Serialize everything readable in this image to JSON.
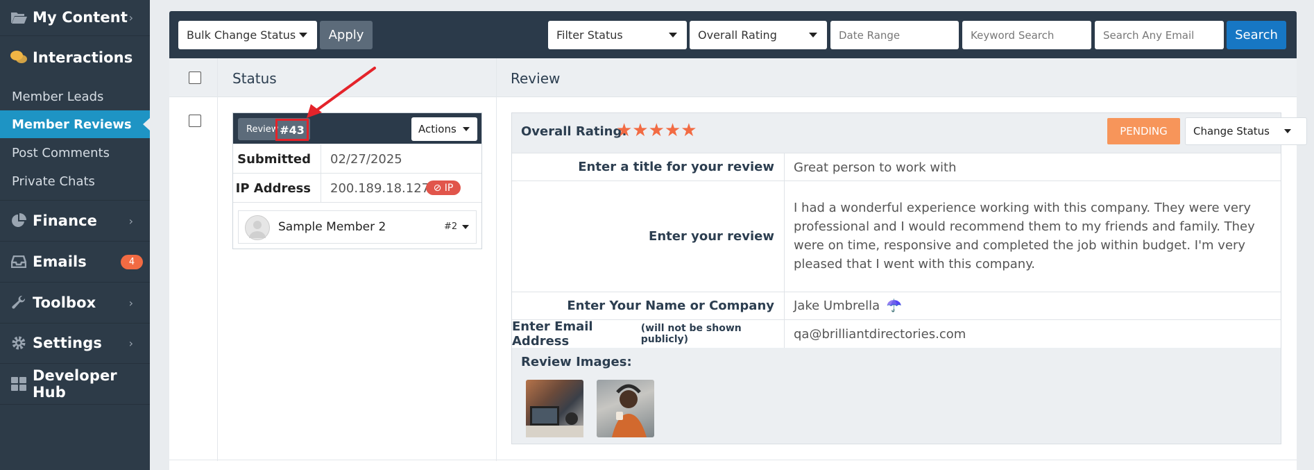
{
  "sidebar": {
    "items": [
      {
        "label": "My Content",
        "icon": "folder-open-icon"
      },
      {
        "label": "Interactions",
        "icon": "comments-icon"
      },
      {
        "label": "Finance",
        "icon": "pie-chart-icon"
      },
      {
        "label": "Emails",
        "icon": "inbox-icon",
        "badge": "4"
      },
      {
        "label": "Toolbox",
        "icon": "wrench-icon"
      },
      {
        "label": "Settings",
        "icon": "gear-icon"
      },
      {
        "label": "Developer Hub",
        "icon": "grid-icon"
      }
    ],
    "sub_items": [
      "Member Leads",
      "Member Reviews",
      "Post Comments",
      "Private Chats"
    ],
    "active_sub": "Member Reviews"
  },
  "toolbar": {
    "bulk_change_status": "Bulk Change Status",
    "apply": "Apply",
    "filter_status": "Filter Status",
    "overall_rating": "Overall Rating",
    "date_range_placeholder": "Date Range",
    "keyword_search_placeholder": "Keyword Search",
    "email_search_placeholder": "Search Any Email",
    "search": "Search"
  },
  "table": {
    "headers": {
      "status": "Status",
      "review": "Review"
    }
  },
  "status_card": {
    "review_label": "Review",
    "review_number": "#43",
    "actions": "Actions",
    "submitted_label": "Submitted",
    "submitted_value": "02/27/2025",
    "ip_label": "IP Address",
    "ip_value": "200.189.18.127",
    "ip_badge": "⊘ IP",
    "member_name": "Sample Member 2",
    "member_number": "#2"
  },
  "review": {
    "overall_label": "Overall Rating:",
    "rating": 5,
    "stars": "★★★★★",
    "status": "PENDING",
    "change_status": "Change Status",
    "fields": {
      "title_label": "Enter a title for your review",
      "title_value": "Great person to work with",
      "review_label": "Enter your review",
      "review_value": "I had a wonderful experience working with this company. They were very professional and I would recommend them to my friends and family. They were on time, responsive and completed the job within budget. I'm very pleased that I went with this company.",
      "name_label": "Enter Your Name or Company",
      "name_value": "Jake Umbrella",
      "name_emoji": "☂️",
      "email_label": "Enter Email Address",
      "email_note": "(will not be shown publicly)",
      "email_value": "qa@brilliantdirectories.com"
    },
    "images_label": "Review Images:"
  },
  "colors": {
    "sidebar_bg": "#2d3b48",
    "active": "#1e94c4",
    "accent": "#f26b43",
    "pending": "#f7955a",
    "search_btn": "#1777c4",
    "annotation": "#e4232a"
  }
}
